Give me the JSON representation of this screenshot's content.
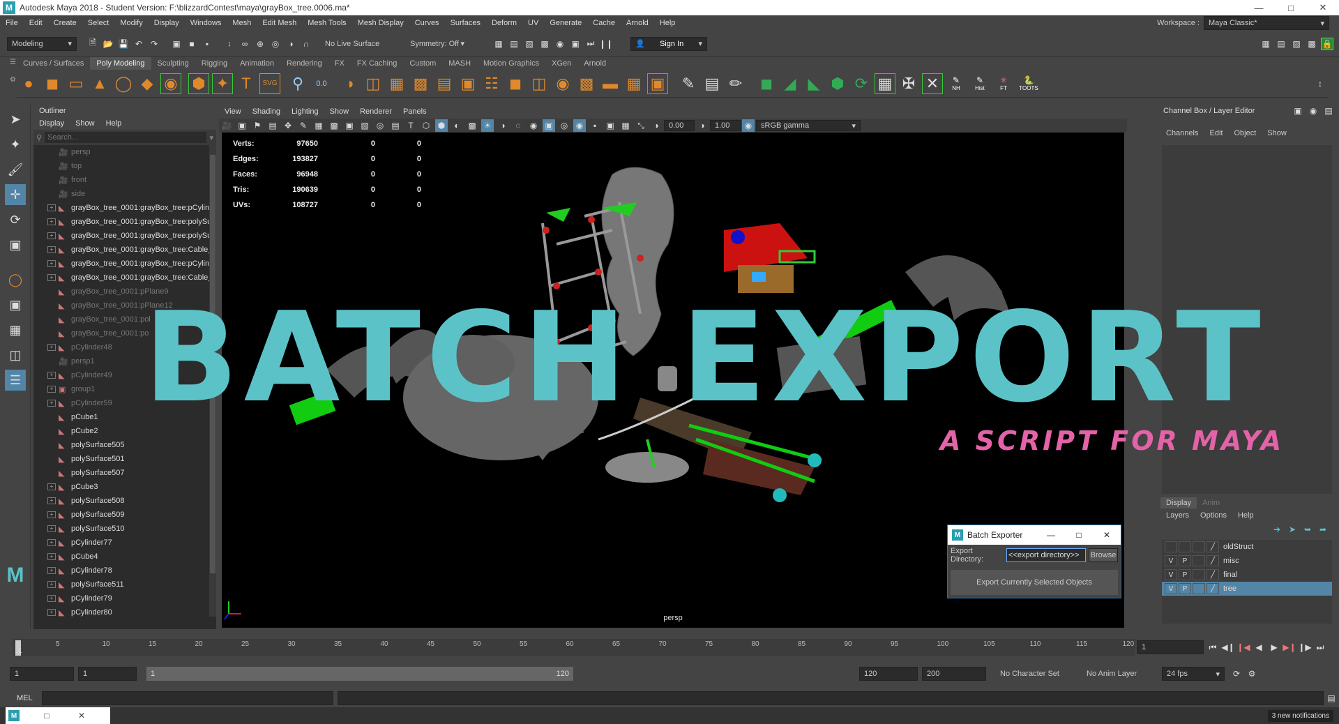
{
  "window": {
    "title": "Autodesk Maya 2018 - Student Version: F:\\blizzardContest\\maya\\grayBox_tree.0006.ma*",
    "logo": "M"
  },
  "menubar": {
    "items": [
      "File",
      "Edit",
      "Create",
      "Select",
      "Modify",
      "Display",
      "Windows",
      "Mesh",
      "Edit Mesh",
      "Mesh Tools",
      "Mesh Display",
      "Curves",
      "Surfaces",
      "Deform",
      "UV",
      "Generate",
      "Cache",
      "Arnold",
      "Help"
    ],
    "workspace_label": "Workspace :",
    "workspace_value": "Maya Classic*"
  },
  "statusline": {
    "mode": "Modeling",
    "live_surface": "No Live Surface",
    "symmetry": "Symmetry: Off",
    "sign_in": "Sign In"
  },
  "shelf_tabs": [
    "Curves / Surfaces",
    "Poly Modeling",
    "Sculpting",
    "Rigging",
    "Animation",
    "Rendering",
    "FX",
    "FX Caching",
    "Custom",
    "MASH",
    "Motion Graphics",
    "XGen",
    "Arnold"
  ],
  "shelf_active": "Poly Modeling",
  "shelf_labels": {
    "nh": "NH",
    "hist": "Hist",
    "ft": "FT",
    "toots": "TOOTS"
  },
  "outliner": {
    "title": "Outliner",
    "menu": [
      "Display",
      "Show",
      "Help"
    ],
    "search_placeholder": "Search...",
    "items": [
      {
        "name": "persp",
        "dim": true,
        "exp": false,
        "type": "cam"
      },
      {
        "name": "top",
        "dim": true,
        "exp": false,
        "type": "cam"
      },
      {
        "name": "front",
        "dim": true,
        "exp": false,
        "type": "cam"
      },
      {
        "name": "side",
        "dim": true,
        "exp": false,
        "type": "cam"
      },
      {
        "name": "grayBox_tree_0001:grayBox_tree:pCylin",
        "dim": false,
        "exp": true,
        "type": "mesh"
      },
      {
        "name": "grayBox_tree_0001:grayBox_tree:polySu",
        "dim": false,
        "exp": true,
        "type": "mesh"
      },
      {
        "name": "grayBox_tree_0001:grayBox_tree:polySu",
        "dim": false,
        "exp": true,
        "type": "mesh"
      },
      {
        "name": "grayBox_tree_0001:grayBox_tree:Cable_",
        "dim": false,
        "exp": true,
        "type": "mesh"
      },
      {
        "name": "grayBox_tree_0001:grayBox_tree:pCylin",
        "dim": false,
        "exp": true,
        "type": "mesh"
      },
      {
        "name": "grayBox_tree_0001:grayBox_tree:Cable_",
        "dim": false,
        "exp": true,
        "type": "mesh"
      },
      {
        "name": "grayBox_tree_0001:pPlane9",
        "dim": true,
        "exp": false,
        "type": "mesh"
      },
      {
        "name": "grayBox_tree_0001:pPlane12",
        "dim": true,
        "exp": false,
        "type": "mesh"
      },
      {
        "name": "grayBox_tree_0001:pol",
        "dim": true,
        "exp": false,
        "type": "mesh"
      },
      {
        "name": "grayBox_tree_0001:po",
        "dim": true,
        "exp": false,
        "type": "mesh"
      },
      {
        "name": "pCylinder48",
        "dim": true,
        "exp": true,
        "type": "mesh"
      },
      {
        "name": "persp1",
        "dim": true,
        "exp": false,
        "type": "cam"
      },
      {
        "name": "pCylinder49",
        "dim": true,
        "exp": true,
        "type": "mesh"
      },
      {
        "name": "group1",
        "dim": true,
        "exp": true,
        "type": "group"
      },
      {
        "name": "pCylinder59",
        "dim": true,
        "exp": true,
        "type": "mesh"
      },
      {
        "name": "pCube1",
        "dim": false,
        "exp": false,
        "type": "mesh"
      },
      {
        "name": "pCube2",
        "dim": false,
        "exp": false,
        "type": "mesh"
      },
      {
        "name": "polySurface505",
        "dim": false,
        "exp": false,
        "type": "mesh"
      },
      {
        "name": "polySurface501",
        "dim": false,
        "exp": false,
        "type": "mesh"
      },
      {
        "name": "polySurface507",
        "dim": false,
        "exp": false,
        "type": "mesh"
      },
      {
        "name": "pCube3",
        "dim": false,
        "exp": true,
        "type": "mesh"
      },
      {
        "name": "polySurface508",
        "dim": false,
        "exp": true,
        "type": "mesh"
      },
      {
        "name": "polySurface509",
        "dim": false,
        "exp": true,
        "type": "mesh"
      },
      {
        "name": "polySurface510",
        "dim": false,
        "exp": true,
        "type": "mesh"
      },
      {
        "name": "pCylinder77",
        "dim": false,
        "exp": true,
        "type": "mesh"
      },
      {
        "name": "pCube4",
        "dim": false,
        "exp": true,
        "type": "mesh"
      },
      {
        "name": "pCylinder78",
        "dim": false,
        "exp": true,
        "type": "mesh"
      },
      {
        "name": "polySurface511",
        "dim": false,
        "exp": true,
        "type": "mesh"
      },
      {
        "name": "pCylinder79",
        "dim": false,
        "exp": true,
        "type": "mesh"
      },
      {
        "name": "pCylinder80",
        "dim": false,
        "exp": true,
        "type": "mesh"
      }
    ]
  },
  "viewport": {
    "menu": [
      "View",
      "Shading",
      "Lighting",
      "Show",
      "Renderer",
      "Panels"
    ],
    "exposure": "0.00",
    "gamma": "1.00",
    "color_space": "sRGB gamma",
    "camera_label": "persp",
    "hud": [
      {
        "label": "Verts:",
        "v1": "97650",
        "v2": "0",
        "v3": "0"
      },
      {
        "label": "Edges:",
        "v1": "193827",
        "v2": "0",
        "v3": "0"
      },
      {
        "label": "Faces:",
        "v1": "96948",
        "v2": "0",
        "v3": "0"
      },
      {
        "label": "Tris:",
        "v1": "190639",
        "v2": "0",
        "v3": "0"
      },
      {
        "label": "UVs:",
        "v1": "108727",
        "v2": "0",
        "v3": "0"
      }
    ]
  },
  "overlay": {
    "title": "BATCH EXPORT",
    "subtitle": "A SCRIPT FOR MAYA"
  },
  "dialog": {
    "title": "Batch Exporter",
    "dir_label": "Export Directory:",
    "dir_value": "<<export directory>>",
    "browse": "Browse",
    "export_button": "Export Currently Selected Objects"
  },
  "channelbox": {
    "title": "Channel Box / Layer Editor",
    "menu": [
      "Channels",
      "Edit",
      "Object",
      "Show"
    ],
    "tabs": [
      "Display",
      "Anim"
    ],
    "layer_menu": [
      "Layers",
      "Options",
      "Help"
    ],
    "layers": [
      {
        "v": "",
        "p": "",
        "name": "oldStruct",
        "sel": false
      },
      {
        "v": "V",
        "p": "P",
        "name": "misc",
        "sel": false
      },
      {
        "v": "V",
        "p": "P",
        "name": "final",
        "sel": false
      },
      {
        "v": "V",
        "p": "P",
        "name": "tree",
        "sel": true
      }
    ]
  },
  "timeline": {
    "ticks": [
      "5",
      "10",
      "15",
      "20",
      "25",
      "30",
      "35",
      "40",
      "45",
      "50",
      "55",
      "60",
      "65",
      "70",
      "75",
      "80",
      "85",
      "90",
      "95",
      "100",
      "105",
      "110",
      "115",
      "120"
    ],
    "current_frame": "1",
    "start_tick": "1"
  },
  "range": {
    "start": "1",
    "inner_start": "1",
    "slider_start": "1",
    "slider_end": "120",
    "end": "120",
    "max": "200",
    "character_set": "No Character Set",
    "anim_layer": "No Anim Layer",
    "fps": "24 fps"
  },
  "cmdline": {
    "label": "MEL"
  },
  "taskbar": {
    "notifications": "3 new notifications"
  },
  "colors": {
    "overlay_title": "#5bc3c8",
    "overlay_sub": "#e463a8",
    "selection": "#5285a6",
    "shelf_orange": "#e0892b"
  }
}
